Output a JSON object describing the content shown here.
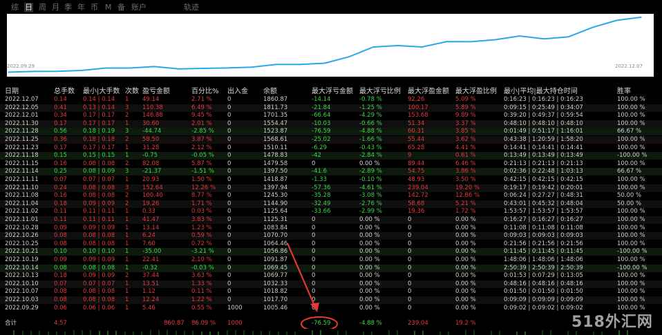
{
  "tabs": [
    {
      "label": "综",
      "active": false
    },
    {
      "label": "日",
      "active": true
    },
    {
      "label": "周",
      "active": false
    },
    {
      "label": "月",
      "active": false
    },
    {
      "label": "季",
      "active": false
    },
    {
      "label": "年",
      "active": false
    },
    {
      "label": "币",
      "active": false
    },
    {
      "label": "M",
      "active": false
    },
    {
      "label": "备",
      "active": false
    },
    {
      "label": "账户",
      "active": false
    },
    {
      "label": "轨迹",
      "active": false
    }
  ],
  "equity_chart": {
    "start_date": "2022.09.29",
    "end_date": "2022.12.07",
    "line_color": "#27a8e8",
    "chart_data": {
      "type": "line",
      "x": [
        "2022.09.29",
        "2022.10.03",
        "2022.10.07",
        "2022.10.10",
        "2022.10.13",
        "2022.10.14",
        "2022.10.19",
        "2022.10.21",
        "2022.10.25",
        "2022.10.26",
        "2022.10.28",
        "2022.11.01",
        "2022.11.02",
        "2022.11.04",
        "2022.11.08",
        "2022.11.10",
        "2022.11.11",
        "2022.11.14",
        "2022.11.15",
        "2022.11.18",
        "2022.11.23",
        "2022.11.25",
        "2022.11.28",
        "2022.11.30",
        "2022.12.01",
        "2022.12.05",
        "2022.12.07"
      ],
      "series": [
        {
          "values": [
            1005.46,
            1017.7,
            1018.82,
            1032.33,
            1069.77,
            1069.45,
            1091.87,
            1056.86,
            1064.46,
            1070.7,
            1083.84,
            1125.31,
            1125.64,
            1144.9,
            1245.3,
            1397.94,
            1418.87,
            1397.5,
            1479.58,
            1478.83,
            1510.11,
            1568.61,
            1523.87,
            1554.47,
            1701.35,
            1811.73,
            1860.87
          ]
        }
      ],
      "ylim": [
        1000,
        1870
      ],
      "grid": false
    }
  },
  "table": {
    "headers": [
      "日期",
      "总手数",
      "最小|大手数",
      "次数",
      "盈亏金额",
      "百分比%",
      "出入金",
      "余额",
      "最大浮亏金额",
      "最大浮亏比例",
      "最大浮盈金额",
      "最大浮盈比例",
      "最小|平均|最大持仓时间",
      "胜率"
    ],
    "rows": [
      {
        "c": [
          "2022.12.07",
          "0.14",
          "0.14 | 0.14",
          "1",
          "49.14",
          "2.71 %",
          "0",
          "1860.87",
          "-14.14",
          "-0.78 %",
          "92.26",
          "5.09 %",
          "0:16:23 | 0:16:23 | 0:16:23",
          "100.00 %"
        ],
        "s": "pos"
      },
      {
        "c": [
          "2022.12.05",
          "0.41",
          "0.13 | 0.14",
          "3",
          "110.38",
          "6.49 %",
          "0",
          "1811.73",
          "-21.84",
          "-1.25 %",
          "100.17",
          "5.89 %",
          "0:09:15 | 0:25:49 | 0:34:07",
          "100.00 %"
        ],
        "s": "pos"
      },
      {
        "c": [
          "2022.12.01",
          "0.34",
          "0.17 | 0.17",
          "2",
          "146.88",
          "9.45 %",
          "0",
          "1701.35",
          "-66.64",
          "-4.29 %",
          "153.68",
          "9.89 %",
          "0:39:20 | 0:49:37 | 0:59:54",
          "100.00 %"
        ],
        "s": "pos"
      },
      {
        "c": [
          "2022.11.30",
          "0.17",
          "0.17 | 0.17",
          "1",
          "30.60",
          "2.01 %",
          "0",
          "1554.47",
          "-10.03",
          "-0.66 %",
          "51.34",
          "3.37 %",
          "0:48:10 | 0:48:10 | 0:48:10",
          "100.00 %"
        ],
        "s": "pos"
      },
      {
        "c": [
          "2022.11.28",
          "0.56",
          "0.18 | 0.19",
          "3",
          "-44.74",
          "-2.85 %",
          "0",
          "1523.87",
          "-76.59",
          "-4.88 %",
          "60.31",
          "3.85 %",
          "0:01:49 | 0:51:17 | 1:16:01",
          "66.67 %"
        ],
        "s": "neg"
      },
      {
        "c": [
          "2022.11.25",
          "0.36",
          "0.18 | 0.18",
          "2",
          "58.50",
          "3.87 %",
          "0",
          "1568.61",
          "-25.02",
          "-1.66 %",
          "55.44",
          "3.62 %",
          "0:43:38 | 1:20:59 | 1:58:20",
          "100.00 %"
        ],
        "s": "pos"
      },
      {
        "c": [
          "2022.11.23",
          "0.17",
          "0.17 | 0.17",
          "1",
          "31.28",
          "2.12 %",
          "0",
          "1510.11",
          "-6.29",
          "-0.43 %",
          "65.28",
          "4.41 %",
          "0:14:41 | 0:14:41 | 0:14:41",
          "100.00 %"
        ],
        "s": "pos"
      },
      {
        "c": [
          "2022.11.18",
          "0.15",
          "0.15 | 0.15",
          "1",
          "-0.75",
          "-0.05 %",
          "0",
          "1478.83",
          "-42",
          "-2.84 %",
          "9",
          "0.61 %",
          "0:13:49 | 0:13:49 | 0:13:49",
          "-100.00 %"
        ],
        "s": "neg"
      },
      {
        "c": [
          "2022.11.15",
          "0.16",
          "0.08 | 0.08",
          "2",
          "82.08",
          "5.87 %",
          "0",
          "1479.58",
          "0",
          "0.00 %",
          "89.44",
          "6.46 %",
          "0:21:13 | 0:21:13 | 0:21:13",
          "100.00 %"
        ],
        "s": "pos"
      },
      {
        "c": [
          "2022.11.14",
          "0.25",
          "0.08 | 0.09",
          "3",
          "-21.37",
          "-1.51 %",
          "0",
          "1397.50",
          "-41.6",
          "-2.89 %",
          "54.75",
          "3.86 %",
          "0:02:36 | 0:22:48 | 1:03:13",
          "66.67 %"
        ],
        "s": "neg"
      },
      {
        "c": [
          "2022.11.11",
          "0.07",
          "0.07 | 0.07",
          "1",
          "20.93",
          "1.50 %",
          "0",
          "1418.87",
          "-1.33",
          "-0.10 %",
          "48.93",
          "3.50 %",
          "0:42:15 | 0:42:15 | 0:42:15",
          "100.00 %"
        ],
        "s": "pos"
      },
      {
        "c": [
          "2022.11.10",
          "0.24",
          "0.08 | 0.08",
          "3",
          "152.64",
          "12.26 %",
          "0",
          "1397.94",
          "-57.36",
          "-4.61 %",
          "239.04",
          "19.20 %",
          "0:19:17 | 0:19:42 | 0:20:01",
          "100.00 %"
        ],
        "s": "pos"
      },
      {
        "c": [
          "2022.11.08",
          "0.16",
          "0.08 | 0.08",
          "2",
          "100.40",
          "8.77 %",
          "0",
          "1245.30",
          "-35.28",
          "-3.08 %",
          "142.72",
          "12.86 %",
          "0:06:24 | 0:27:27 | 0:48:31",
          "50.00 %"
        ],
        "s": "pos"
      },
      {
        "c": [
          "2022.11.04",
          "0.18",
          "0.09 | 0.09",
          "2",
          "19.26",
          "1.71 %",
          "0",
          "1144.90",
          "-32.49",
          "-2.76 %",
          "58.68",
          "5.21 %",
          "0:43:01 | 0:45:32 | 0:48:04",
          "50.00 %"
        ],
        "s": "pos"
      },
      {
        "c": [
          "2022.11.02",
          "0.11",
          "0.11 | 0.11",
          "1",
          "0.33",
          "0.03 %",
          "0",
          "1125.64",
          "-33.66",
          "-2.99 %",
          "19.36",
          "1.72 %",
          "1:53:57 | 1:53:57 | 1:53:57",
          "100.00 %"
        ],
        "s": "pos"
      },
      {
        "c": [
          "2022.11.01",
          "0.11",
          "0.11 | 0.11",
          "1",
          "41.47",
          "3.83 %",
          "0",
          "1125.31",
          "0",
          "0.00 %",
          "0",
          "0.00 %",
          "0:16:27 | 0:16:27 | 0:16:27",
          "100.00 %"
        ],
        "s": "pos"
      },
      {
        "c": [
          "2022.10.28",
          "0.09",
          "0.09 | 0.09",
          "1",
          "13.14",
          "1.23 %",
          "0",
          "1083.84",
          "0",
          "0.00 %",
          "0",
          "0.00 %",
          "0:11:08 | 0:11:08 | 0:11:08",
          "100.00 %"
        ],
        "s": "pos"
      },
      {
        "c": [
          "2022.10.26",
          "0.08",
          "0.08 | 0.08",
          "1",
          "6.24",
          "0.59 %",
          "0",
          "1070.70",
          "0",
          "0.00 %",
          "0",
          "0.00 %",
          "0:09:03 | 0:09:03 | 0:09:03",
          "100.00 %"
        ],
        "s": "pos"
      },
      {
        "c": [
          "2022.10.25",
          "0.08",
          "0.08 | 0.08",
          "1",
          "7.60",
          "0.72 %",
          "0",
          "1064.46",
          "0",
          "0.00 %",
          "0",
          "0.00 %",
          "0:21:56 | 0:21:56 | 0:21:56",
          "100.00 %"
        ],
        "s": "pos"
      },
      {
        "c": [
          "2022.10.21",
          "0.10",
          "0.10 | 0.10",
          "1",
          "-35.00",
          "-3.21 %",
          "0",
          "1056.86",
          "0",
          "0.00 %",
          "0",
          "0.00 %",
          "0:11:45 | 0:11:45 | 0:11:45",
          "-100.00 %"
        ],
        "s": "neg"
      },
      {
        "c": [
          "2022.10.19",
          "0.09",
          "0.09 | 0.09",
          "1",
          "22.41",
          "2.10 %",
          "0",
          "1091.87",
          "0",
          "0.00 %",
          "0",
          "0.00 %",
          "1:48:06 | 1:48:06 | 1:48:06",
          "100.00 %"
        ],
        "s": "pos"
      },
      {
        "c": [
          "2022.10.14",
          "0.08",
          "0.08 | 0.08",
          "1",
          "-0.32",
          "-0.03 %",
          "0",
          "1069.45",
          "0",
          "0.00 %",
          "0",
          "0.00 %",
          "2:50:39 | 2:50:39 | 2:50:39",
          "-100.00 %"
        ],
        "s": "neg"
      },
      {
        "c": [
          "2022.10.13",
          "0.18",
          "0.09 | 0.09",
          "2",
          "37.44",
          "3.63 %",
          "0",
          "1069.77",
          "0",
          "0.00 %",
          "0",
          "0.00 %",
          "0:01:53 | 0:07:29 | 0:13:05",
          "100.00 %"
        ],
        "s": "pos"
      },
      {
        "c": [
          "2022.10.10",
          "0.07",
          "0.07 | 0.07",
          "1",
          "13.51",
          "1.33 %",
          "0",
          "1032.33",
          "0",
          "0.00 %",
          "0",
          "0.00 %",
          "0:48:16 | 0:48:16 | 0:48:16",
          "100.00 %"
        ],
        "s": "pos"
      },
      {
        "c": [
          "2022.10.07",
          "0.08",
          "0.08 | 0.08",
          "1",
          "1.12",
          "0.11 %",
          "0",
          "1018.82",
          "0",
          "0.00 %",
          "0",
          "0.00 %",
          "0:01:50 | 0:01:50 | 0:01:50",
          "100.00 %"
        ],
        "s": "pos"
      },
      {
        "c": [
          "2022.10.03",
          "0.08",
          "0.08 | 0.08",
          "1",
          "12.24",
          "1.22 %",
          "0",
          "1017.70",
          "0",
          "0.00 %",
          "0",
          "0.00 %",
          "0:09:09 | 0:09:09 | 0:09:09",
          "100.00 %"
        ],
        "s": "pos"
      },
      {
        "c": [
          "2022.09.29",
          "0.06",
          "0.06 | 0.06",
          "1",
          "5.46",
          "0.55 %",
          "1000",
          "1005.46",
          "0",
          "0.00 %",
          "0",
          "0.00 %",
          "0:09:02 | 0:09:02 | 0:09:02",
          "100.00 %"
        ],
        "s": "pos"
      }
    ],
    "total": {
      "label": "合计",
      "lots": "4.57",
      "profit": "860.87",
      "pct": "86.09 %",
      "deposit": "1000",
      "max_float_loss": "-76.59",
      "max_float_loss_pct": "-4.88 %",
      "max_float_profit": "239.04",
      "max_float_profit_pct": "19.2 %"
    }
  },
  "watermark": "518外汇网",
  "colors": {
    "profit": "#e8383b",
    "loss": "#3fd64a",
    "highlight": "#e53935"
  },
  "icons": {
    "annotation": "red-arrow-icon"
  }
}
